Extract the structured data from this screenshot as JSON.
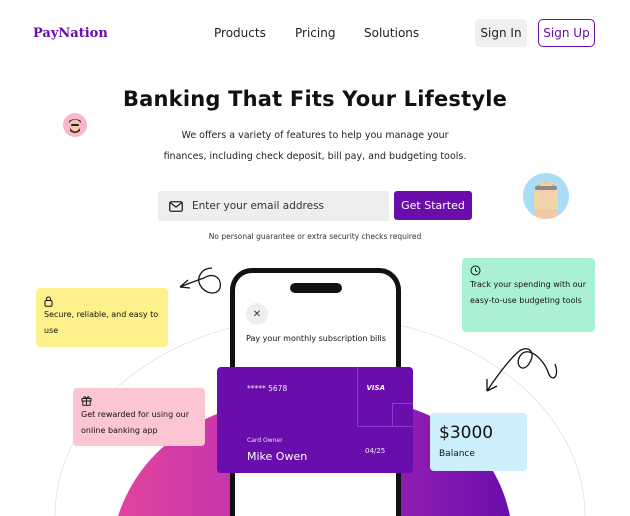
{
  "brand": {
    "name": "PayNation",
    "color": "#6a0dad"
  },
  "nav": {
    "items": [
      "Products",
      "Pricing",
      "Solutions"
    ],
    "signin": "Sign In",
    "signup": "Sign Up"
  },
  "hero": {
    "title": "Banking That Fits Your Lifestyle",
    "subtitle_line1": "We offers a variety of features to help you manage your",
    "subtitle_line2": "finances, including check deposit, bill pay, and budgeting tools.",
    "email_placeholder": "Enter your email address",
    "cta": "Get Started",
    "note": "No personal guarantee or extra security checks required"
  },
  "features": {
    "secure": {
      "icon": "lock-icon",
      "text": "Secure, reliable, and easy to use"
    },
    "rewards": {
      "icon": "gift-icon",
      "text": "Get rewarded for using our online banking app"
    },
    "budget": {
      "icon": "clock-icon",
      "text": "Track your spending with our easy-to-use budgeting tools"
    }
  },
  "phone": {
    "close_icon": "close-icon",
    "message": "Pay your monthly subscription bills"
  },
  "card": {
    "number": "***** 5678",
    "brand": "VISA",
    "owner_label": "Card Owner",
    "owner_name": "Mike Owen",
    "expiry": "04/25"
  },
  "balance": {
    "amount": "$3000",
    "label": "Balance"
  },
  "colors": {
    "purple": "#6a0dad",
    "yellow": "#fef08a",
    "pink": "#fbc5d3",
    "green": "#aaf0d4",
    "blue": "#cdeffc"
  }
}
